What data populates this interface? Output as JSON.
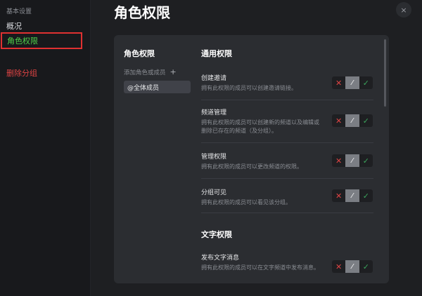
{
  "sidebar": {
    "section_title": "基本设置",
    "items": [
      {
        "label": "概况"
      },
      {
        "label": "角色权限"
      },
      {
        "label": "删除分组"
      }
    ]
  },
  "header": {
    "title": "角色权限",
    "close_icon": "×"
  },
  "roles": {
    "title": "角色权限",
    "add_label": "添加角色或成员",
    "add_icon": "+",
    "selected_role": "@全体成员"
  },
  "permissions": {
    "groups": [
      {
        "title": "通用权限"
      },
      {
        "title": "文字权限"
      }
    ],
    "items": [
      {
        "name": "创建邀请",
        "desc": "拥有此权限的成员可以创建邀请链接。"
      },
      {
        "name": "频道管理",
        "desc": "拥有此权限的成员可以创建新的频道以及编辑或删除已存在的频道（及分组）。"
      },
      {
        "name": "管理权限",
        "desc": "拥有此权限的成员可以更改频道的权限。"
      },
      {
        "name": "分组可见",
        "desc": "拥有此权限的成员可以看见该分组。"
      },
      {
        "name": "发布文字消息",
        "desc": "拥有此权限的成员可以在文字频道中发布消息。"
      }
    ],
    "toggle": {
      "deny": "✕",
      "neutral": "⁄",
      "allow": "✓"
    }
  },
  "colors": {
    "accent_selected": "#4fd14a",
    "danger": "#e04444",
    "highlight_border": "#e03131"
  }
}
